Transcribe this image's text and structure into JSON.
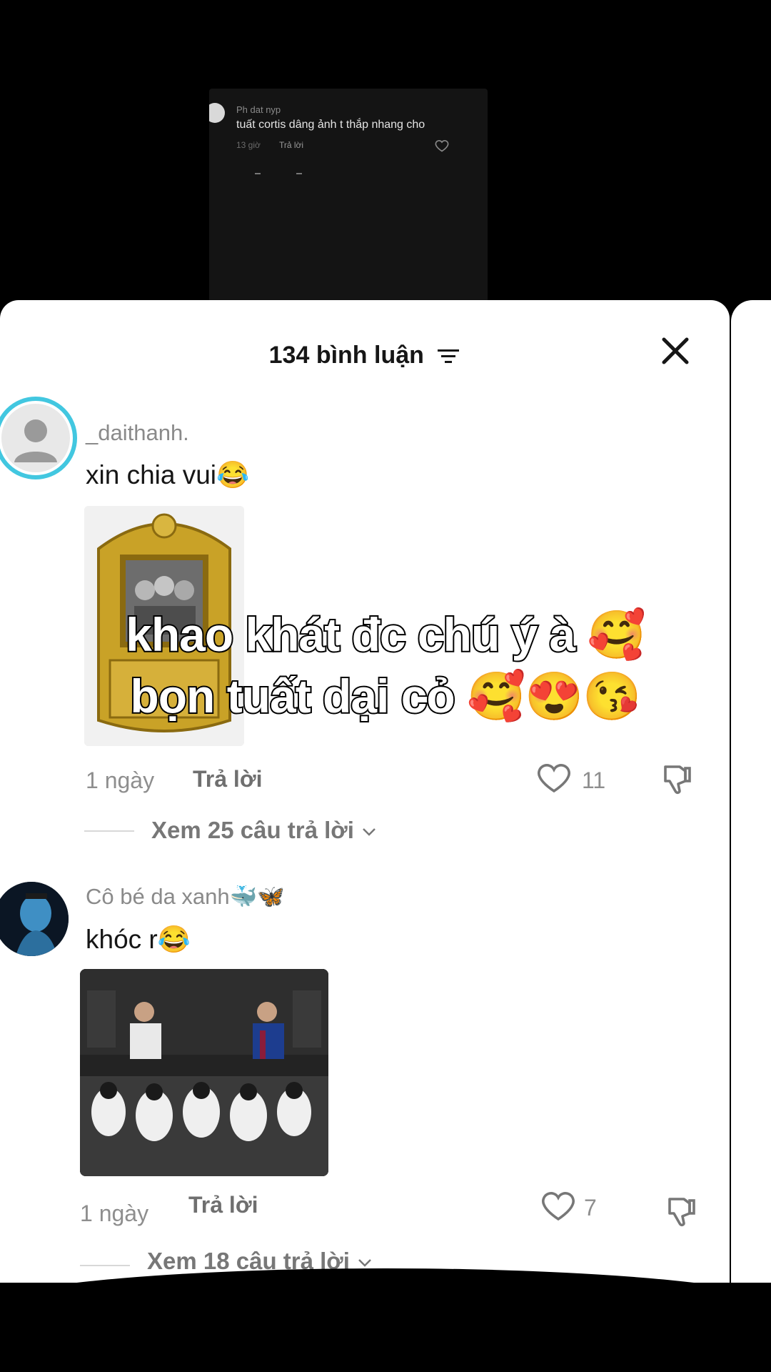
{
  "snippet": {
    "username": "Ph dat nyp",
    "text": "tuất cortis dâng ảnh t thắp nhang cho",
    "time": "13 giờ",
    "reply": "Trả lời"
  },
  "header": {
    "title": "134 bình luận"
  },
  "overlay": {
    "line1": "khao khát đc chú ý à 🥰",
    "line2": "bọn tuất dại cỏ 🥰😍😘"
  },
  "comments": [
    {
      "username": "_daithanh.",
      "text": "xin chia vui😂",
      "time": "1 ngày",
      "reply": "Trả lời",
      "likes": "11",
      "view_replies": "Xem 25 câu trả lời"
    },
    {
      "username": "Cô bé da xanh🐳🦋",
      "text": "khóc r😂",
      "time": "1 ngày",
      "reply": "Trả lời",
      "likes": "7",
      "view_replies": "Xem 18 câu trả lời"
    }
  ],
  "icons": {
    "filter": "filter-icon",
    "close": "close-icon",
    "heart": "heart-icon",
    "dislike": "thumbs-down-icon",
    "chevron": "chevron-down-icon"
  }
}
